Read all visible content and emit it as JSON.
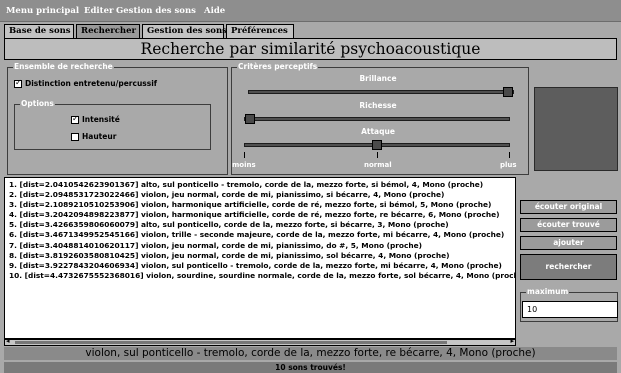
{
  "menu": [
    "Menu principal",
    "Editer",
    "Gestion des sons",
    "Aide"
  ],
  "tabs": [
    {
      "label": "Base de sons",
      "active": false
    },
    {
      "label": "Rechercher",
      "active": true
    },
    {
      "label": "Gestion des sons",
      "active": false
    },
    {
      "label": "Préférences",
      "active": false
    }
  ],
  "page_title": "Recherche par similarité psychoacoustique",
  "ensemble": {
    "legend": "Ensemble de recherche",
    "distinction_label": "Distinction entretenu/percussif",
    "distinction_checked": true,
    "options_legend": "Options",
    "intensite_label": "Intensité",
    "intensite_checked": true,
    "hauteur_label": "Hauteur",
    "hauteur_checked": false
  },
  "criteres": {
    "legend": "Critères perceptifs",
    "sliders": [
      {
        "label": "Brillance",
        "level": 1.0
      },
      {
        "label": "Richesse",
        "level": 0.0
      },
      {
        "label": "Attaque",
        "level": 0.5
      }
    ],
    "scale_labels": [
      "moins",
      "normal",
      "plus"
    ]
  },
  "results": [
    "1. [dist=2.0410542623901367] alto, sul ponticello - tremolo, corde de la, mezzo forte, si bémol, 4, Mono (proche)",
    "2. [dist=2.0948531723022466] violon, jeu normal, corde de mi, pianissimo, si bécarre, 4, Mono (proche)",
    "3. [dist=2.1089210510253906] violon, harmonique artificielle, corde de ré, mezzo forte, si bémol, 5, Mono (proche)",
    "4. [dist=3.2042094898223877] violon, harmonique artificielle, corde de ré, mezzo forte, re bécarre, 6, Mono (proche)",
    "5. [dist=3.4266359806060079] alto, sul ponticello, corde de la, mezzo forte, si bécarre, 3, Mono (proche)",
    "6. [dist=3.4671349952545166] violon, trille - seconde majeure, corde de la, mezzo forte, mi bécarre, 4, Mono (proche)",
    "7. [dist=3.4048814010620117] violon, jeu normal, corde de mi, pianissimo, do #, 5, Mono (proche)",
    "8. [dist=3.8192603580810425] violon, jeu normal, corde de mi, pianissimo, sol bécarre, 4, Mono (proche)",
    "9. [dist=3.9227843204606934] violon, sul ponticello - tremolo, corde de la, mezzo forte, mi bécarre, 4, Mono (proche)",
    "10. [dist=4.4732675552368016] violon, sourdine, sourdine normale, corde de la, mezzo forte, sol bécarre, 4, Mono (proche)"
  ],
  "buttons": {
    "ecouter_original": "écouter original",
    "ecouter_trouve": "écouter trouvé",
    "ajouter": "ajouter",
    "rechercher": "rechercher"
  },
  "maximum": {
    "legend": "maximum",
    "value": "10"
  },
  "status_selected": "violon, sul ponticello - tremolo, corde de la, mezzo forte, re bécarre, 4, Mono (proche)",
  "status_count": "10 sons trouvés!"
}
